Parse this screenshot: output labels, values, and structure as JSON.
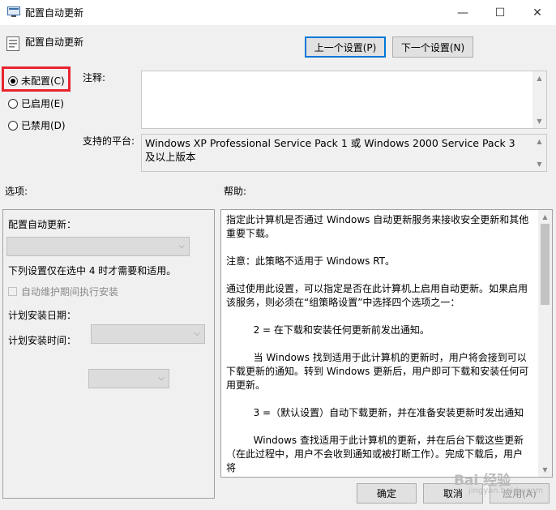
{
  "window": {
    "title": "配置自动更新",
    "controls": {
      "minimize": "—",
      "maximize": "☐",
      "close": "✕"
    }
  },
  "header": {
    "policy_title": "配置自动更新",
    "prev_button": "上一个设置(P)",
    "next_button": "下一个设置(N)"
  },
  "state_options": [
    {
      "label": "未配置(C)",
      "checked": true
    },
    {
      "label": "已启用(E)",
      "checked": false
    },
    {
      "label": "已禁用(D)",
      "checked": false
    }
  ],
  "comment": {
    "label": "注释:",
    "value": ""
  },
  "platform": {
    "label": "支持的平台:",
    "value": "Windows XP Professional Service Pack 1 或 Windows 2000 Service Pack 3 及以上版本"
  },
  "options": {
    "section_label": "选项:",
    "configure_label": "配置自动更新：",
    "configure_value": "",
    "note": "下列设置仅在选中 4 时才需要和适用。",
    "maintenance_checkbox": "自动维护期间执行安装",
    "install_day_label": "计划安装日期：",
    "install_day_value": "",
    "install_time_label": "计划安装时间：",
    "install_time_value": ""
  },
  "help": {
    "section_label": "帮助:",
    "paragraphs": [
      "指定此计算机是否通过 Windows 自动更新服务来接收安全更新和其他重要下载。",
      "注意：此策略不适用于 Windows RT。",
      "通过使用此设置，可以指定是否在此计算机上启用自动更新。如果启用该服务，则必须在“组策略设置”中选择四个选项之一：",
      "2 = 在下载和安装任何更新前发出通知。",
      "当 Windows 找到适用于此计算机的更新时，用户将会接到可以下载更新的通知。转到 Windows 更新后，用户即可下载和安装任何可用更新。",
      "3 =（默认设置）自动下载更新，并在准备安装更新时发出通知",
      "Windows 查找适用于此计算机的更新，并在后台下载这些更新（在此过程中，用户不会收到通知或被打断工作）。完成下载后，用户将"
    ]
  },
  "footer": {
    "ok_button": "确定",
    "cancel_button": "取消",
    "apply_button": "应用(A)"
  },
  "watermark": {
    "text": "Bai 经验",
    "sub": "jingyan.baidu.com"
  },
  "colors": {
    "highlight": "#e8242f",
    "default_button_border": "#0078d7"
  }
}
